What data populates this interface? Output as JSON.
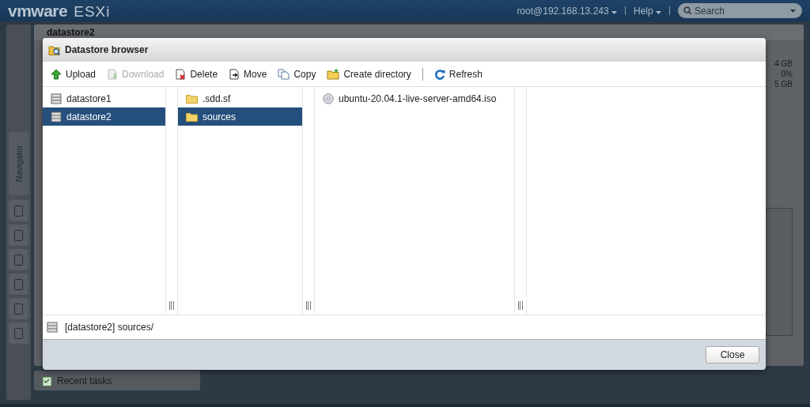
{
  "header": {
    "logo": "vmware",
    "product": "ESXi",
    "user": "root@192.168.13.243",
    "help": "Help",
    "search": {
      "placeholder": "Search"
    }
  },
  "navigator": {
    "label": "Navigator"
  },
  "background_panel": {
    "title": "datastore2",
    "stats": [
      "4 GB",
      "0%",
      "5 GB"
    ]
  },
  "dialog": {
    "title": "Datastore browser",
    "toolbar": [
      {
        "label": "Upload",
        "kind": "upload",
        "disabled": false
      },
      {
        "label": "Download",
        "kind": "download",
        "disabled": true
      },
      {
        "label": "Delete",
        "kind": "delete",
        "disabled": false
      },
      {
        "label": "Move",
        "kind": "move",
        "disabled": false
      },
      {
        "label": "Copy",
        "kind": "copy",
        "disabled": false
      },
      {
        "label": "Create directory",
        "kind": "mkdir",
        "disabled": false
      },
      {
        "label": "Refresh",
        "kind": "refresh",
        "disabled": false
      }
    ],
    "columns": [
      {
        "items": [
          {
            "name": "datastore1",
            "kind": "datastore",
            "selected": false
          },
          {
            "name": "datastore2",
            "kind": "datastore",
            "selected": true
          }
        ]
      },
      {
        "items": [
          {
            "name": ".sdd.sf",
            "kind": "folder",
            "selected": false
          },
          {
            "name": "sources",
            "kind": "folder",
            "selected": true
          }
        ]
      },
      {
        "items": [
          {
            "name": "ubuntu-20.04.1-live-server-amd64.iso",
            "kind": "iso",
            "selected": false
          }
        ]
      }
    ],
    "path": "[datastore2] sources/",
    "close": "Close"
  },
  "recent_tasks": "Recent tasks"
}
